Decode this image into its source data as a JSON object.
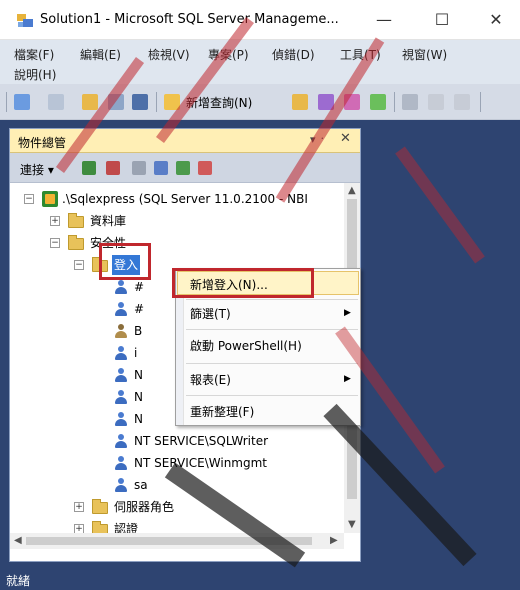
{
  "window": {
    "title": "Solution1 - Microsoft SQL Server Manageme...",
    "minimize_glyph": "—",
    "maximize_glyph": "☐",
    "close_glyph": "✕"
  },
  "menu": {
    "items": [
      "檔案(F)",
      "編輯(E)",
      "檢視(V)",
      "專案(P)",
      "偵錯(D)",
      "工具(T)",
      "視窗(W)",
      "說明(H)"
    ]
  },
  "toolbar": {
    "new_query_label": "新增查詢(N)"
  },
  "object_explorer": {
    "title": "物件總管",
    "pin_glyph": "▾ ᛫",
    "close_glyph": "✕",
    "connect_label": "連接 ▾",
    "tree": {
      "server": ".\\Sqlexpress (SQL Server 11.0.2100 - NBI",
      "databases": "資料庫",
      "security": "安全性",
      "logins": "登入",
      "login_items": [
        "#",
        "#",
        "B",
        "i",
        "N",
        "N",
        "N"
      ],
      "nt_sqlwriter": "NT SERVICE\\SQLWriter",
      "nt_winmgmt": "NT SERVICE\\Winmgmt",
      "sa": "sa",
      "server_roles": "伺服器角色",
      "credentials": "認證"
    }
  },
  "context_menu": {
    "new_login": "新增登入(N)...",
    "filter": "篩選(T)",
    "start_powershell": "啟動 PowerShell(H)",
    "reports": "報表(E)",
    "refresh": "重新整理(F)"
  },
  "status": {
    "text": "就緒"
  },
  "colors": {
    "workspace": "#2e4471",
    "annotation_red": "#c0272d",
    "highlight": "#fff4c8"
  }
}
